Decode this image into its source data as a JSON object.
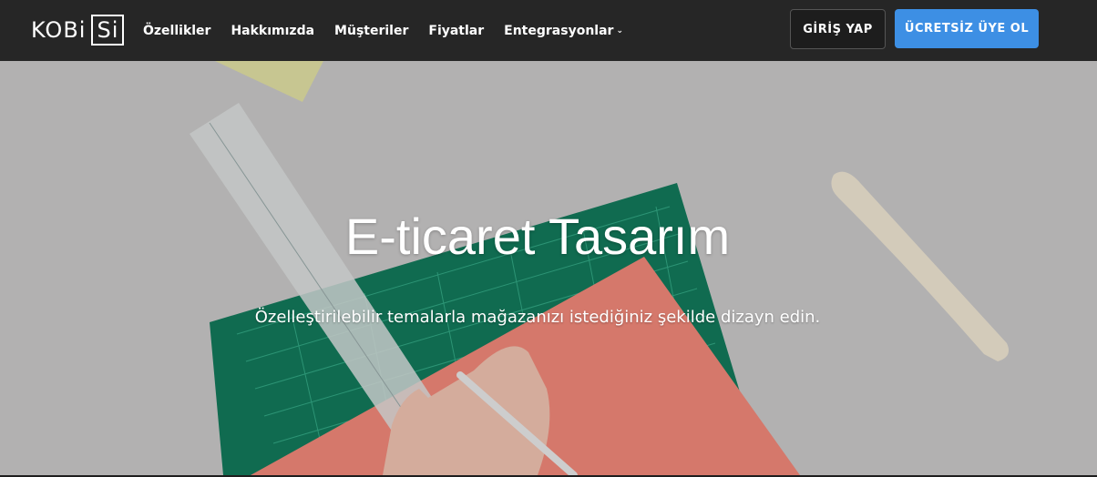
{
  "brand": {
    "logo_text_left": "KOBi",
    "logo_text_boxed": "Si"
  },
  "nav": {
    "items": [
      {
        "label": "Özellikler"
      },
      {
        "label": "Hakkımızda"
      },
      {
        "label": "Müşteriler"
      },
      {
        "label": "Fiyatlar"
      },
      {
        "label": "Entegrasyonlar",
        "has_dropdown": true
      }
    ],
    "caret": "⌄"
  },
  "auth": {
    "login_label": "GİRİŞ YAP",
    "signup_label": "ÜCRETSİZ ÜYE OL"
  },
  "hero": {
    "title": "E-ticaret Tasarım",
    "subtitle": "Özelleştirilebilir temalarla mağazanızı istediğiniz şekilde dizayn edin."
  },
  "colors": {
    "navbar_bg": "#262626",
    "signup_bg": "#3d8fe4",
    "cutting_mat": "#137a5c",
    "paper": "#f3897a"
  }
}
